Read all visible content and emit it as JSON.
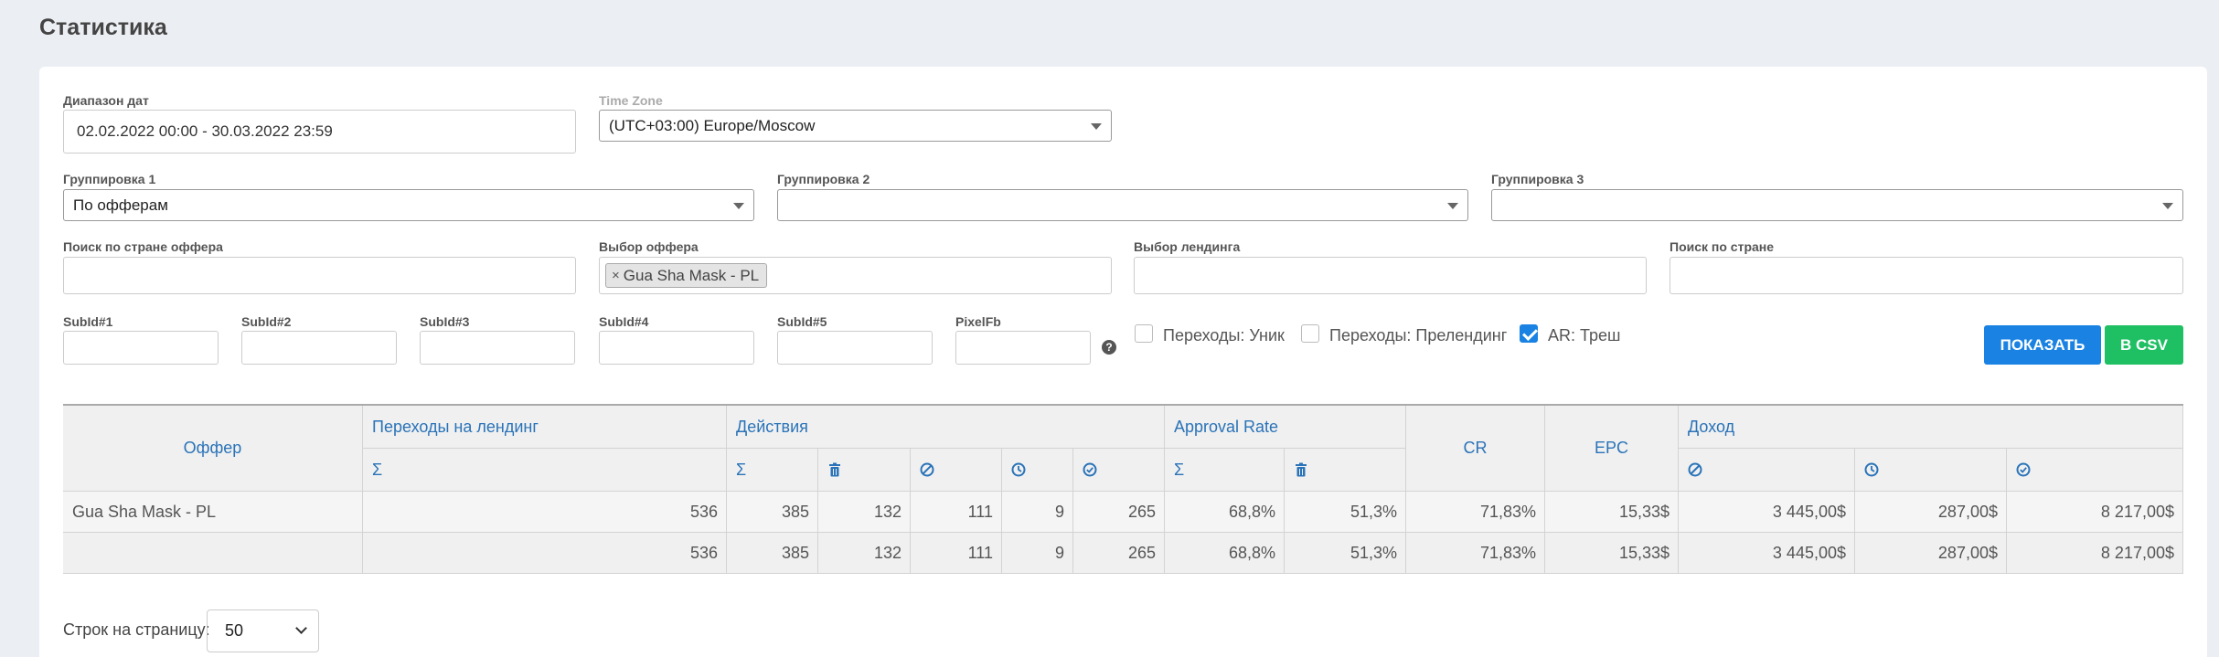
{
  "page_title": "Статистика",
  "filters": {
    "date_range": {
      "label": "Диапазон дат",
      "value": "02.02.2022 00:00 - 30.03.2022 23:59"
    },
    "time_zone": {
      "label": "Time Zone",
      "value": "(UTC+03:00) Europe/Moscow"
    },
    "group1": {
      "label": "Группировка 1",
      "value": "По офферам"
    },
    "group2": {
      "label": "Группировка 2",
      "value": ""
    },
    "group3": {
      "label": "Группировка 3",
      "value": ""
    },
    "offer_country": {
      "label": "Поиск по стране оффера",
      "value": ""
    },
    "offer_select": {
      "label": "Выбор оффера",
      "tag": "Gua Sha Mask - PL",
      "remove": "×"
    },
    "landing_select": {
      "label": "Выбор лендинга",
      "value": ""
    },
    "country": {
      "label": "Поиск по стране",
      "value": ""
    },
    "subids": [
      "SubId#1",
      "SubId#2",
      "SubId#3",
      "SubId#4",
      "SubId#5"
    ],
    "pixel": {
      "label": "PixelFb",
      "help": "?"
    },
    "checkboxes": [
      {
        "label": "Переходы: Уник",
        "checked": false
      },
      {
        "label": "Переходы: Прелендинг",
        "checked": false
      },
      {
        "label": "AR: Треш",
        "checked": true
      }
    ],
    "show_button": "ПОКАЗАТЬ",
    "csv_button": "В CSV"
  },
  "table": {
    "headers": {
      "offer": "Оффер",
      "clicks": "Переходы на лендинг",
      "actions": "Действия",
      "approval": "Approval Rate",
      "cr": "CR",
      "epc": "EPC",
      "income": "Доход"
    },
    "sigma": "Σ",
    "rows": [
      {
        "name": "Gua Sha Mask - PL",
        "values": [
          "536",
          "385",
          "132",
          "111",
          "9",
          "265",
          "68,8%",
          "51,3%",
          "71,83%",
          "15,33$",
          "3 445,00$",
          "287,00$",
          "8 217,00$"
        ]
      },
      {
        "name": "",
        "values": [
          "536",
          "385",
          "132",
          "111",
          "9",
          "265",
          "68,8%",
          "51,3%",
          "71,83%",
          "15,33$",
          "3 445,00$",
          "287,00$",
          "8 217,00$"
        ]
      }
    ]
  },
  "pager": {
    "label": "Строк на страницу:",
    "value": "50"
  },
  "colors": {
    "accent": "#1a82e2",
    "success": "#1fbf63",
    "header_text": "#2a73b8"
  },
  "icons": [
    "trash-icon",
    "cancel-icon",
    "clock-icon",
    "check-circle-icon"
  ]
}
